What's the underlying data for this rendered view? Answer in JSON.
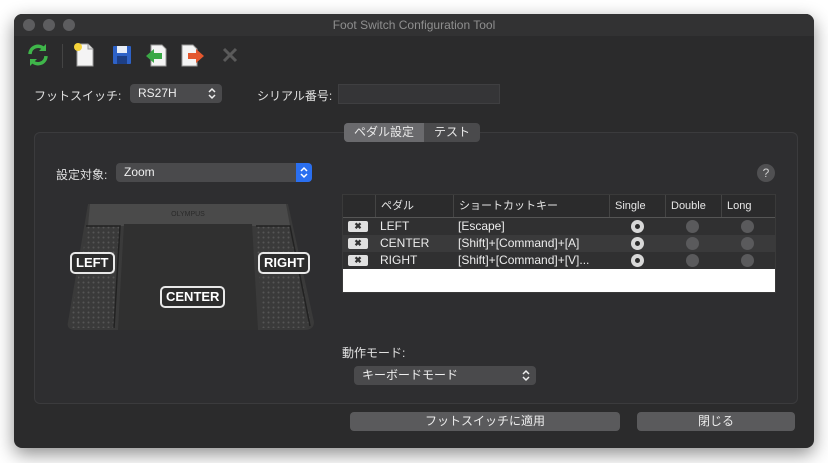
{
  "window": {
    "title": "Foot Switch Configuration Tool"
  },
  "toolbar": {
    "icons": [
      "refresh-icon",
      "new-file-icon",
      "save-icon",
      "import-icon",
      "export-icon",
      "close-x-icon"
    ]
  },
  "device": {
    "label": "フットスイッチ:",
    "value": "RS27H",
    "serial_label": "シリアル番号:",
    "serial_value": ""
  },
  "tabs": [
    {
      "label": "ペダル設定",
      "selected": true
    },
    {
      "label": "テスト",
      "selected": false
    }
  ],
  "target": {
    "label": "設定対象:",
    "value": "Zoom"
  },
  "help": {
    "label": "?"
  },
  "pedal_image": {
    "brand": "OLYMPUS",
    "left": "LEFT",
    "center": "CENTER",
    "right": "RIGHT"
  },
  "table": {
    "headers": [
      "ペダル",
      "ショートカットキー",
      "Single",
      "Double",
      "Long"
    ],
    "rows": [
      {
        "pedal": "LEFT",
        "shortcut": "[Escape]",
        "mode": "Single"
      },
      {
        "pedal": "CENTER",
        "shortcut": "[Shift]+[Command]+[A]",
        "mode": "Single"
      },
      {
        "pedal": "RIGHT",
        "shortcut": "[Shift]+[Command]+[V]...",
        "mode": "Single"
      }
    ]
  },
  "operation_mode": {
    "label": "動作モード:",
    "value": "キーボードモード"
  },
  "buttons": {
    "apply": "フットスイッチに適用",
    "close": "閉じる"
  },
  "colors": {
    "accent": "#2a6ff0",
    "window_bg": "#2b2b2c"
  }
}
